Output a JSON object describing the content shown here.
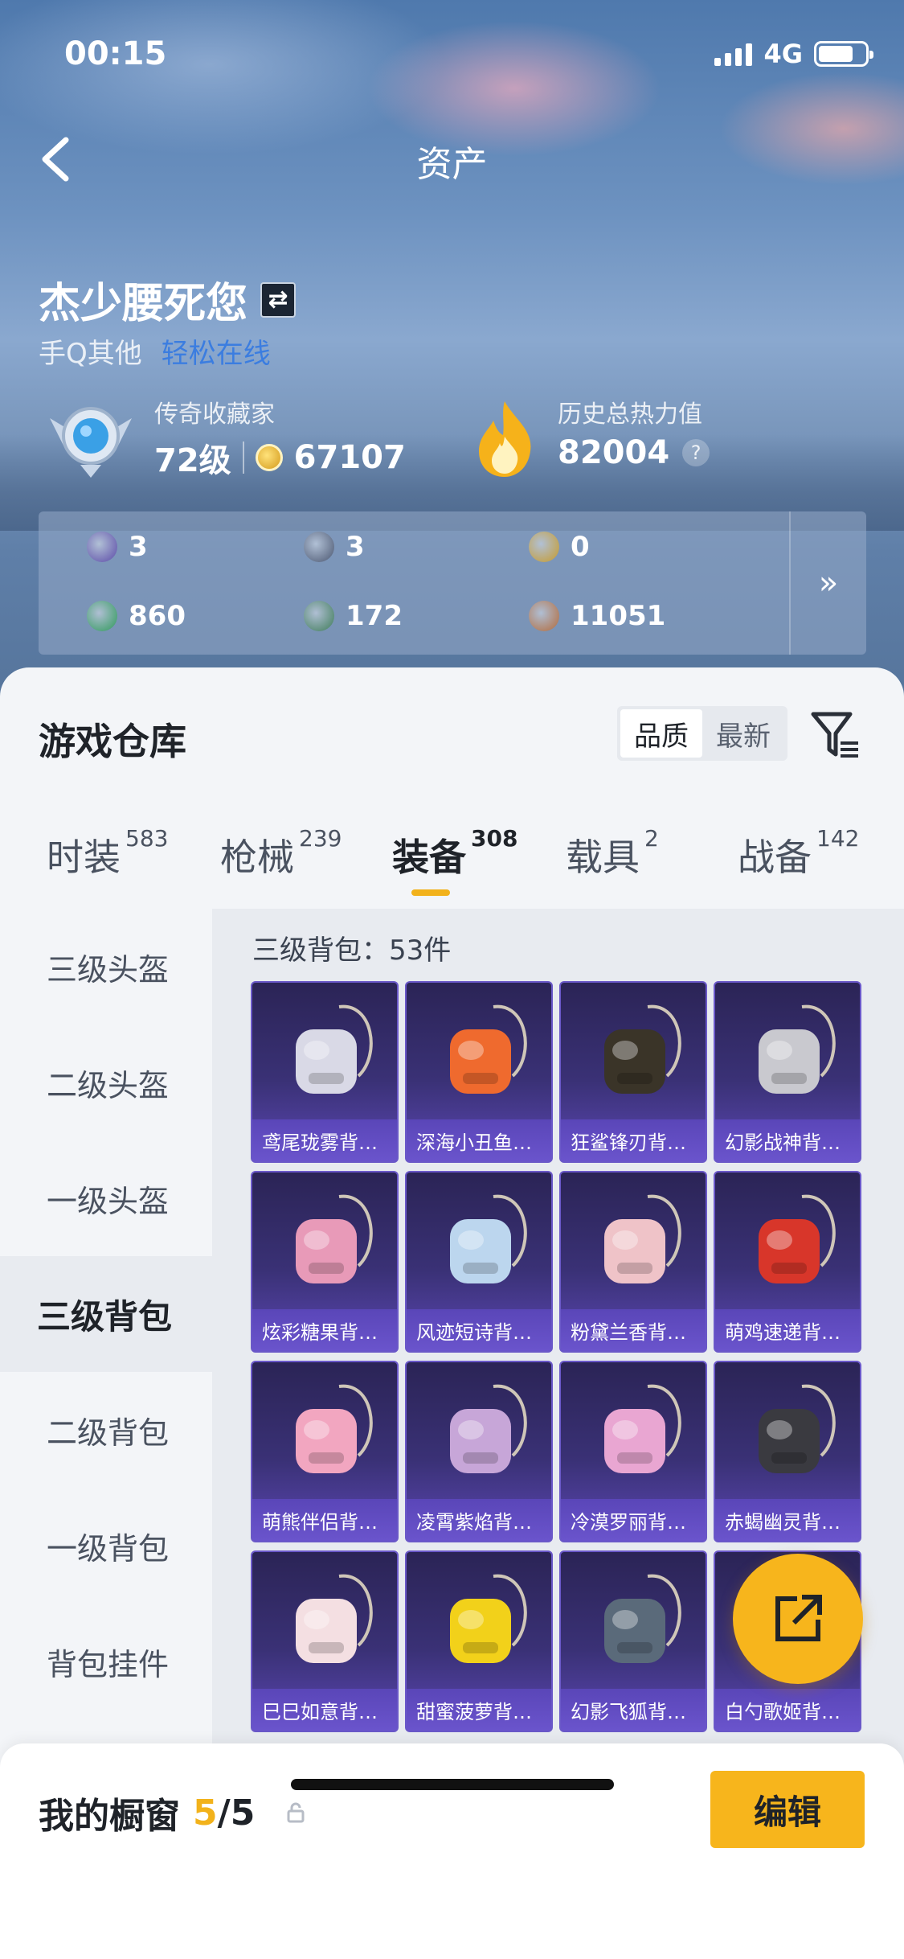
{
  "status_bar": {
    "time": "00:15",
    "network": "4G",
    "battery_level": 0.75
  },
  "nav": {
    "title": "资产",
    "back_icon": "chevron-left-icon"
  },
  "profile": {
    "nickname": "杰少腰死您",
    "platform": "手Q其他",
    "online_status": "轻松在线",
    "rank_title": "传奇收藏家",
    "level": "72级",
    "collection_score": "67107",
    "heat_label": "历史总热力值",
    "heat_value": "82004",
    "help": "?"
  },
  "currency": [
    {
      "icon": "card-icon",
      "value": "3",
      "color": "#5b4aa8"
    },
    {
      "icon": "ring-token-icon",
      "value": "3",
      "color": "#4a5670"
    },
    {
      "icon": "gold-token-icon",
      "value": "0",
      "color": "#c69a2a"
    },
    {
      "icon": "green-card-icon",
      "value": "860",
      "color": "#2e9a5a"
    },
    {
      "icon": "green-coin-icon",
      "value": "172",
      "color": "#3e7c58"
    },
    {
      "icon": "bronze-coin-icon",
      "value": "11051",
      "color": "#b26a3a"
    }
  ],
  "currency_more": "»",
  "warehouse": {
    "title": "游戏仓库",
    "sort_options": [
      "品质",
      "最新"
    ],
    "active_sort": "品质"
  },
  "tabs": [
    {
      "label": "时装",
      "count": "583"
    },
    {
      "label": "枪械",
      "count": "239"
    },
    {
      "label": "装备",
      "count": "308"
    },
    {
      "label": "载具",
      "count": "2"
    },
    {
      "label": "战备",
      "count": "142"
    }
  ],
  "active_tab": "装备",
  "sidebar": [
    {
      "label": "三级头盔"
    },
    {
      "label": "二级头盔"
    },
    {
      "label": "一级头盔"
    },
    {
      "label": "三级背包"
    },
    {
      "label": "二级背包"
    },
    {
      "label": "一级背包"
    },
    {
      "label": "背包挂件"
    }
  ],
  "active_category": "三级背包",
  "content_header": "三级背包：53件",
  "items": [
    {
      "name": "鸢尾珑雾背…",
      "color": "#d9d9e6"
    },
    {
      "name": "深海小丑鱼…",
      "color": "#ef6a2e"
    },
    {
      "name": "狂鲨锋刃背…",
      "color": "#3a3428"
    },
    {
      "name": "幻影战神背…",
      "color": "#c9c9cf"
    },
    {
      "name": "炫彩糖果背…",
      "color": "#e89ab8"
    },
    {
      "name": "风迹短诗背…",
      "color": "#bcd6ee"
    },
    {
      "name": "粉黛兰香背…",
      "color": "#efc3c8"
    },
    {
      "name": "萌鸡速递背…",
      "color": "#d8362a"
    },
    {
      "name": "萌熊伴侣背…",
      "color": "#f2a6c0"
    },
    {
      "name": "凌霄紫焰背…",
      "color": "#c7a6d8"
    },
    {
      "name": "冷漠罗丽背…",
      "color": "#e9a6d2"
    },
    {
      "name": "赤蝎幽灵背…",
      "color": "#3a3a40"
    },
    {
      "name": "巳巳如意背…",
      "color": "#f4dfe2"
    },
    {
      "name": "甜蜜菠萝背…",
      "color": "#f2d11a"
    },
    {
      "name": "幻影飞狐背…",
      "color": "#5a6a7a"
    },
    {
      "name": "白勺歌姬背…",
      "color": "#e8e0f0"
    }
  ],
  "showcase": {
    "label": "我的橱窗",
    "current": "5",
    "total": "/5",
    "edit": "编辑"
  }
}
